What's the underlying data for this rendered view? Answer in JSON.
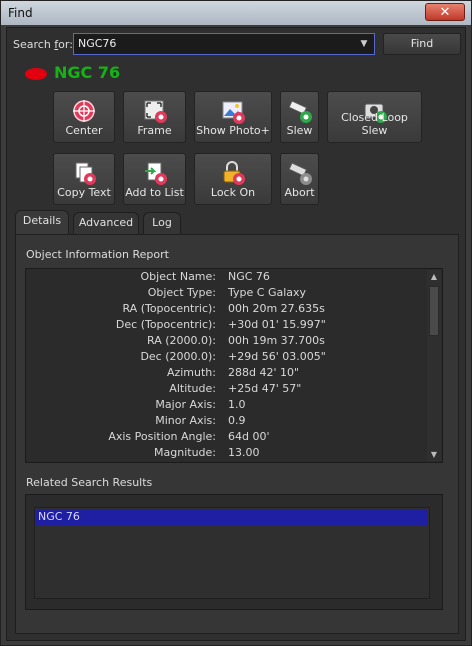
{
  "window": {
    "title": "Find",
    "close": "✕"
  },
  "search": {
    "label_pre": "Search ",
    "label_underlined": "f",
    "label_post": "or:",
    "value": "NGC76",
    "find_label": "Find"
  },
  "object": {
    "name": "NGC 76",
    "status_color": "#e2000e"
  },
  "toolbar": {
    "row1": [
      "Center",
      "Frame",
      "Show Photo+",
      "Slew",
      "Closed Loop Slew"
    ],
    "row2": [
      "Copy Text",
      "Add to List",
      "Lock On",
      "Abort"
    ]
  },
  "tabs": [
    "Details",
    "Advanced",
    "Log"
  ],
  "active_tab": "Details",
  "report": {
    "title": "Object Information Report",
    "rows": [
      {
        "label": "Object Name:",
        "value": "NGC 76"
      },
      {
        "label": "Object Type:",
        "value": "Type C Galaxy"
      },
      {
        "label": "RA (Topocentric):",
        "value": "00h 20m 27.635s"
      },
      {
        "label": "Dec (Topocentric):",
        "value": "+30d 01' 15.997\""
      },
      {
        "label": "RA (2000.0):",
        "value": "00h 19m 37.700s"
      },
      {
        "label": "Dec (2000.0):",
        "value": "+29d 56' 03.005\""
      },
      {
        "label": "Azimuth:",
        "value": "288d 42' 10\""
      },
      {
        "label": "Altitude:",
        "value": "+25d 47' 57\""
      },
      {
        "label": "Major Axis:",
        "value": "1.0"
      },
      {
        "label": "Minor Axis:",
        "value": "0.9"
      },
      {
        "label": "Axis Position Angle:",
        "value": "64d 00'"
      },
      {
        "label": "Magnitude:",
        "value": "13.00"
      }
    ]
  },
  "related": {
    "title": "Related Search Results",
    "items": [
      "NGC 76"
    ]
  }
}
